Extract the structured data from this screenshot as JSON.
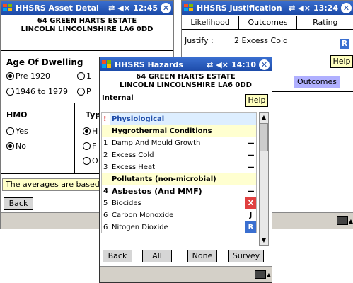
{
  "colors": {
    "titlebar": "#1c4aa8",
    "help_bg": "#ffffc0",
    "category_bg": "#ffffd0",
    "info_bg": "#ffffc8",
    "mark_x": "#e04040",
    "mark_r": "#3a6fd0",
    "outcomes_btn": "#b0b0ff"
  },
  "asset": {
    "title": "HHSRS Asset Detai",
    "time": "12:45",
    "address1": "64 GREEN HARTS ESTATE",
    "address2": "LINCOLN LINCOLNSHIRE LA6 0DD",
    "age_heading": "Age Of Dwelling",
    "age_options": [
      {
        "label": "Pre 1920",
        "selected": true
      },
      {
        "label": "1",
        "selected": false
      },
      {
        "label": "1946 to 1979",
        "selected": false
      },
      {
        "label": "P",
        "selected": false
      }
    ],
    "hmo_heading": "HMO",
    "hmo_options": [
      {
        "label": "Yes",
        "selected": false
      },
      {
        "label": "No",
        "selected": true
      }
    ],
    "type_heading": "Typ",
    "type_options": [
      {
        "label": "H",
        "selected": true
      },
      {
        "label": "F",
        "selected": false
      },
      {
        "label": "O",
        "selected": false
      }
    ],
    "info": "The averages are based",
    "back": "Back"
  },
  "justification": {
    "title": "HHSRS Justification",
    "time": "13:24",
    "tabs": [
      "Likelihood",
      "Outcomes",
      "Rating"
    ],
    "justify_label": "Justify :",
    "justify_value": "2 Excess Cold",
    "r_badge": "R",
    "help": "Help",
    "outcomes_button": "Outcomes"
  },
  "hazards": {
    "title": "HHSRS Hazards",
    "time": "14:10",
    "address1": "64 GREEN HARTS ESTATE",
    "address2": "LINCOLN LINCOLNSHIRE LA6 0DD",
    "section": "Internal",
    "help": "Help",
    "warning_glyph": "!",
    "rows": [
      {
        "num": "",
        "label": "Physiological",
        "mark": "",
        "kind": "header"
      },
      {
        "num": "",
        "label": "Hygrothermal Conditions",
        "mark": "",
        "kind": "cat"
      },
      {
        "num": "1",
        "label": "Damp And Mould Growth",
        "mark": "—",
        "kind": "item"
      },
      {
        "num": "2",
        "label": "Excess Cold",
        "mark": "—",
        "kind": "item"
      },
      {
        "num": "3",
        "label": "Excess Heat",
        "mark": "—",
        "kind": "item"
      },
      {
        "num": "",
        "label": "Pollutants (non-microbial)",
        "mark": "",
        "kind": "cat"
      },
      {
        "num": "4",
        "label": "Asbestos (And MMF)",
        "mark": "—",
        "kind": "big"
      },
      {
        "num": "5",
        "label": "Biocides",
        "mark": "X",
        "kind": "item"
      },
      {
        "num": "6",
        "label": "Carbon Monoxide",
        "mark": "J",
        "kind": "item"
      },
      {
        "num": "6",
        "label": "Nitogen Dioxide",
        "mark": "R",
        "kind": "item"
      }
    ],
    "buttons": {
      "back": "Back",
      "all": "All",
      "none": "None",
      "survey": "Survey"
    }
  }
}
